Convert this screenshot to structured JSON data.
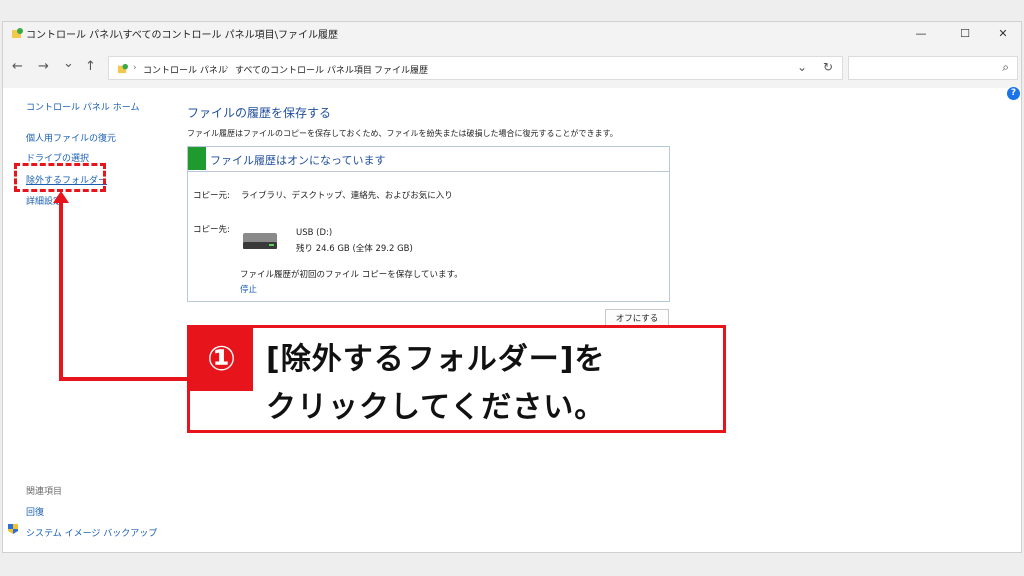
{
  "window": {
    "title": "コントロール パネル\\すべてのコントロール パネル項目\\ファイル履歴",
    "minimize": "—",
    "maximize": "☐",
    "close": "✕"
  },
  "nav": {
    "back": "←",
    "forward": "→",
    "recent": "⌄",
    "up": "↑"
  },
  "address": {
    "crumbs": [
      "コントロール パネル",
      "すべてのコントロール パネル項目",
      "ファイル履歴"
    ],
    "separator": "›",
    "dropdown": "⌄",
    "refresh": "↻"
  },
  "search": {
    "placeholder": "",
    "icon": "⌕"
  },
  "help": "?",
  "sidebar": {
    "home": "コントロール パネル ホーム",
    "items": [
      "個人用ファイルの復元",
      "ドライブの選択",
      "除外するフォルダー",
      "詳細設定"
    ],
    "related_heading": "関連項目",
    "related": [
      "回復",
      "システム イメージ バックアップ"
    ]
  },
  "main": {
    "title": "ファイルの履歴を保存する",
    "description": "ファイル履歴はファイルのコピーを保存しておくため、ファイルを紛失または破損した場合に復元することができます。",
    "status_title": "ファイル履歴はオンになっています",
    "source_label": "コピー元:",
    "source_value": "ライブラリ、デスクトップ、連絡先、およびお気に入り",
    "dest_label": "コピー先:",
    "drive_name": "USB (D:)",
    "drive_space": "残り 24.6 GB (全体 29.2 GB)",
    "progress_text": "ファイル履歴が初回のファイル コピーを保存しています。",
    "stop_link": "停止",
    "off_button": "オフにする"
  },
  "annotation": {
    "number": "①",
    "line1": "[除外するフォルダー]を",
    "line2": "クリックしてください。",
    "color": "#e8141c"
  }
}
